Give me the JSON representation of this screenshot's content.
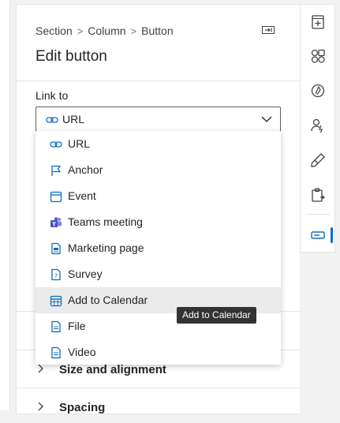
{
  "breadcrumb": {
    "items": [
      "Section",
      "Column",
      "Button"
    ],
    "separator": ">"
  },
  "panel": {
    "title": "Edit button"
  },
  "link": {
    "label": "Link to",
    "selected": "URL",
    "options": [
      "URL",
      "Anchor",
      "Event",
      "Teams meeting",
      "Marketing page",
      "Survey",
      "Add to Calendar",
      "File",
      "Video"
    ],
    "option_icons": [
      "link-icon",
      "flag-icon",
      "calendar-icon",
      "teams-icon",
      "page-icon",
      "survey-icon",
      "calendar-grid-icon",
      "file-icon",
      "file-icon"
    ],
    "hovered": "Add to Calendar"
  },
  "tooltip": {
    "text": "Add to Calendar"
  },
  "sections": [
    {
      "title": "Size and alignment",
      "expanded": false
    },
    {
      "title": "Spacing",
      "expanded": false
    }
  ],
  "rail": {
    "icons": [
      "add-section-icon",
      "elements-icon",
      "brand-icon",
      "personalization-icon",
      "styles-icon",
      "clipboard-icon",
      "button-properties-icon"
    ],
    "active": "button-properties-icon"
  },
  "colors": {
    "accent": "#0f6cbd",
    "tooltip_bg": "#333333",
    "hover_bg": "#ebebeb"
  }
}
